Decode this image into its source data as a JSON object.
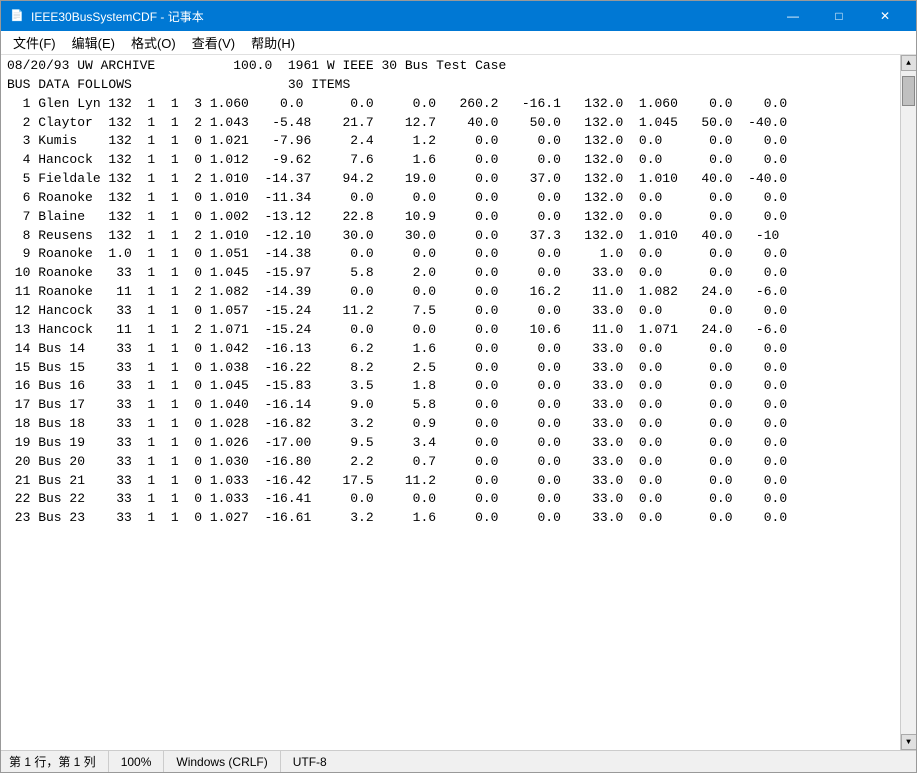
{
  "window": {
    "title": "IEEE30BusSystemCDF - 记事本",
    "title_icon": "📄"
  },
  "title_controls": {
    "minimize": "—",
    "maximize": "□",
    "close": "✕"
  },
  "menu": {
    "items": [
      {
        "label": "文件(F)"
      },
      {
        "label": "编辑(E)"
      },
      {
        "label": "格式(O)"
      },
      {
        "label": "查看(V)"
      },
      {
        "label": "帮助(H)"
      }
    ]
  },
  "content": {
    "lines": [
      "08/20/93 UW ARCHIVE          100.0  1961 W IEEE 30 Bus Test Case",
      "BUS DATA FOLLOWS                    30 ITEMS",
      "  1 Glen Lyn 132  1  1  3 1.060    0.0      0.0     0.0   260.2   -16.1   132.0  1.060    0.0    0.0",
      "  2 Claytor  132  1  1  2 1.043   -5.48    21.7    12.7    40.0    50.0   132.0  1.045   50.0  -40.0",
      "  3 Kumis    132  1  1  0 1.021   -7.96     2.4     1.2     0.0     0.0   132.0  0.0      0.0    0.0",
      "  4 Hancock  132  1  1  0 1.012   -9.62     7.6     1.6     0.0     0.0   132.0  0.0      0.0    0.0",
      "  5 Fieldale 132  1  1  2 1.010  -14.37    94.2    19.0     0.0    37.0   132.0  1.010   40.0  -40.0",
      "  6 Roanoke  132  1  1  0 1.010  -11.34     0.0     0.0     0.0     0.0   132.0  0.0      0.0    0.0",
      "  7 Blaine   132  1  1  0 1.002  -13.12    22.8    10.9     0.0     0.0   132.0  0.0      0.0    0.0",
      "  8 Reusens  132  1  1  2 1.010  -12.10    30.0    30.0     0.0    37.3   132.0  1.010   40.0   -10",
      "  9 Roanoke  1.0  1  1  0 1.051  -14.38     0.0     0.0     0.0     0.0     1.0  0.0      0.0    0.0",
      " 10 Roanoke   33  1  1  0 1.045  -15.97     5.8     2.0     0.0     0.0    33.0  0.0      0.0    0.0",
      " 11 Roanoke   11  1  1  2 1.082  -14.39     0.0     0.0     0.0    16.2    11.0  1.082   24.0   -6.0",
      " 12 Hancock   33  1  1  0 1.057  -15.24    11.2     7.5     0.0     0.0    33.0  0.0      0.0    0.0",
      " 13 Hancock   11  1  1  2 1.071  -15.24     0.0     0.0     0.0    10.6    11.0  1.071   24.0   -6.0",
      " 14 Bus 14    33  1  1  0 1.042  -16.13     6.2     1.6     0.0     0.0    33.0  0.0      0.0    0.0",
      " 15 Bus 15    33  1  1  0 1.038  -16.22     8.2     2.5     0.0     0.0    33.0  0.0      0.0    0.0",
      " 16 Bus 16    33  1  1  0 1.045  -15.83     3.5     1.8     0.0     0.0    33.0  0.0      0.0    0.0",
      " 17 Bus 17    33  1  1  0 1.040  -16.14     9.0     5.8     0.0     0.0    33.0  0.0      0.0    0.0",
      " 18 Bus 18    33  1  1  0 1.028  -16.82     3.2     0.9     0.0     0.0    33.0  0.0      0.0    0.0",
      " 19 Bus 19    33  1  1  0 1.026  -17.00     9.5     3.4     0.0     0.0    33.0  0.0      0.0    0.0",
      " 20 Bus 20    33  1  1  0 1.030  -16.80     2.2     0.7     0.0     0.0    33.0  0.0      0.0    0.0",
      " 21 Bus 21    33  1  1  0 1.033  -16.42    17.5    11.2     0.0     0.0    33.0  0.0      0.0    0.0",
      " 22 Bus 22    33  1  1  0 1.033  -16.41     0.0     0.0     0.0     0.0    33.0  0.0      0.0    0.0",
      " 23 Bus 23    33  1  1  0 1.027  -16.61     3.2     1.6     0.0     0.0    33.0  0.0      0.0    0.0"
    ]
  },
  "status_bar": {
    "position": "第 1 行，第 1 列",
    "zoom": "100%",
    "line_ending": "Windows (CRLF)",
    "encoding": "UTF-8"
  }
}
